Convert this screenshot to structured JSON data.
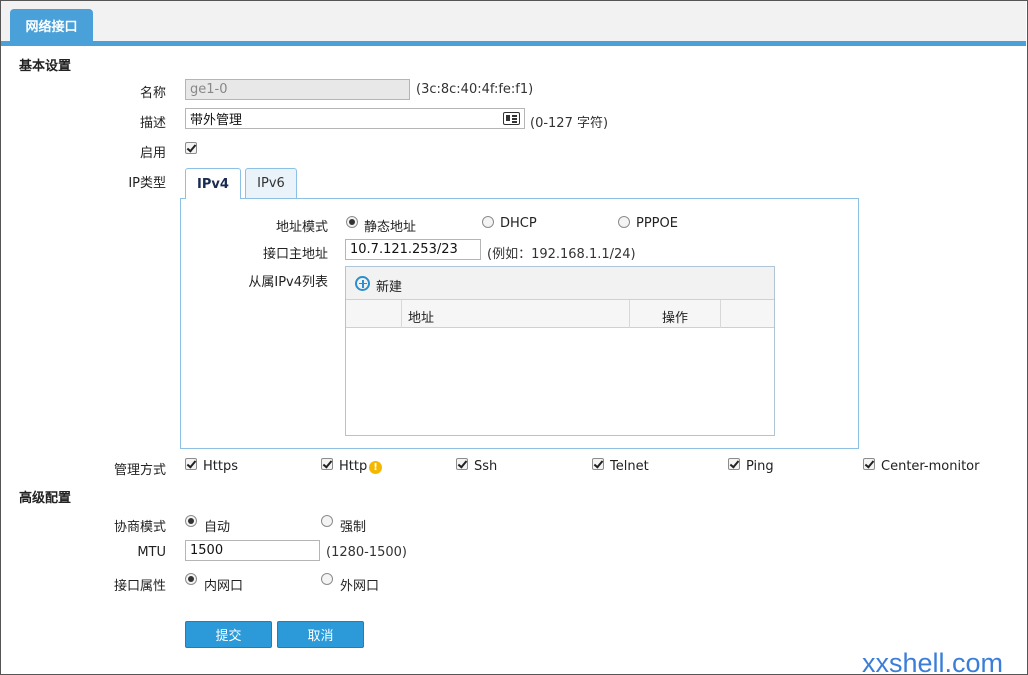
{
  "tab": {
    "title": "网络接口"
  },
  "basic": {
    "section_title": "基本设置",
    "name_label": "名称",
    "name_value": "ge1-0",
    "mac_hint": "(3c:8c:40:4f:fe:f1)",
    "desc_label": "描述",
    "desc_value": "带外管理",
    "desc_hint": "(0-127 字符)",
    "enable_label": "启用",
    "iptype_label": "IP类型"
  },
  "ip_tabs": [
    "IPv4",
    "IPv6"
  ],
  "ipv4": {
    "mode_label": "地址模式",
    "modes": [
      "静态地址",
      "DHCP",
      "PPPOE"
    ],
    "primary_label": "接口主地址",
    "primary_value": "10.7.121.253/23",
    "primary_hint": "(例如：192.168.1.1/24)",
    "secondary_label": "从属IPv4列表",
    "new_label": "新建",
    "columns": [
      "地址",
      "操作"
    ]
  },
  "mgmt": {
    "label": "管理方式",
    "options": [
      "Https",
      "Http",
      "Ssh",
      "Telnet",
      "Ping",
      "Center-monitor"
    ]
  },
  "advanced": {
    "section_title": "高级配置",
    "negotiation_label": "协商模式",
    "negotiation_options": [
      "自动",
      "强制"
    ],
    "mtu_label": "MTU",
    "mtu_value": "1500",
    "mtu_hint": "(1280-1500)",
    "attr_label": "接口属性",
    "attr_options": [
      "内网口",
      "外网口"
    ]
  },
  "buttons": {
    "submit": "提交",
    "cancel": "取消"
  },
  "watermark": "xxshell.com",
  "colors": {
    "accent": "#4aa0d8",
    "button": "#2c9ad8",
    "warning": "#f5b800"
  }
}
